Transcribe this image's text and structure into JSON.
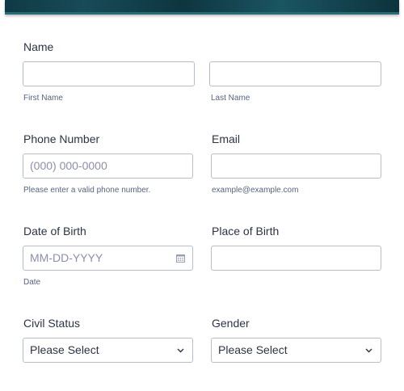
{
  "name": {
    "label": "Name",
    "first_sublabel": "First Name",
    "last_sublabel": "Last Name",
    "first_value": "",
    "last_value": ""
  },
  "phone": {
    "label": "Phone Number",
    "placeholder": "(000) 000-0000",
    "sublabel": "Please enter a valid phone number."
  },
  "email": {
    "label": "Email",
    "sublabel": "example@example.com",
    "value": ""
  },
  "dob": {
    "label": "Date of Birth",
    "placeholder": "MM-DD-YYYY",
    "sublabel": "Date"
  },
  "pob": {
    "label": "Place of Birth",
    "value": ""
  },
  "civil_status": {
    "label": "Civil Status",
    "selected": "Please Select"
  },
  "gender": {
    "label": "Gender",
    "selected": "Please Select"
  },
  "colors": {
    "text": "#2c3345",
    "border": "#b8bdc9",
    "placeholder": "#8d8fa8",
    "banner": "#0f3a45"
  },
  "icons": {
    "calendar": "calendar-icon",
    "dropdown": "chevron-down-icon"
  }
}
